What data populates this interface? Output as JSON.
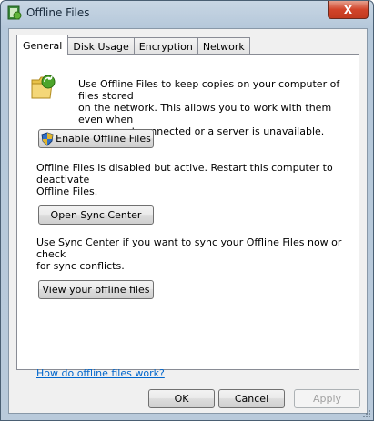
{
  "window": {
    "title": "Offline Files",
    "close_label": "X"
  },
  "tabs": [
    {
      "label": "General"
    },
    {
      "label": "Disk Usage"
    },
    {
      "label": "Encryption"
    },
    {
      "label": "Network"
    }
  ],
  "general": {
    "intro_text_line1": "Use Offline Files to keep copies on your computer of files stored",
    "intro_text_line2": "on the network.  This allows you to work with them even when",
    "intro_text_line3": "you are not connected or a server is unavailable.",
    "enable_button": "Enable Offline Files",
    "status_line1": "Offline Files is disabled but active.  Restart this computer to deactivate",
    "status_line2": "Offline Files.",
    "sync_button": "Open Sync Center",
    "sync_text_line1": "Use Sync Center if you want to sync your Offline Files now or check",
    "sync_text_line2": "for sync conflicts.",
    "view_button": "View your offline files",
    "help_link": "How do offline files work?"
  },
  "footer": {
    "ok": "OK",
    "cancel": "Cancel",
    "apply": "Apply"
  }
}
